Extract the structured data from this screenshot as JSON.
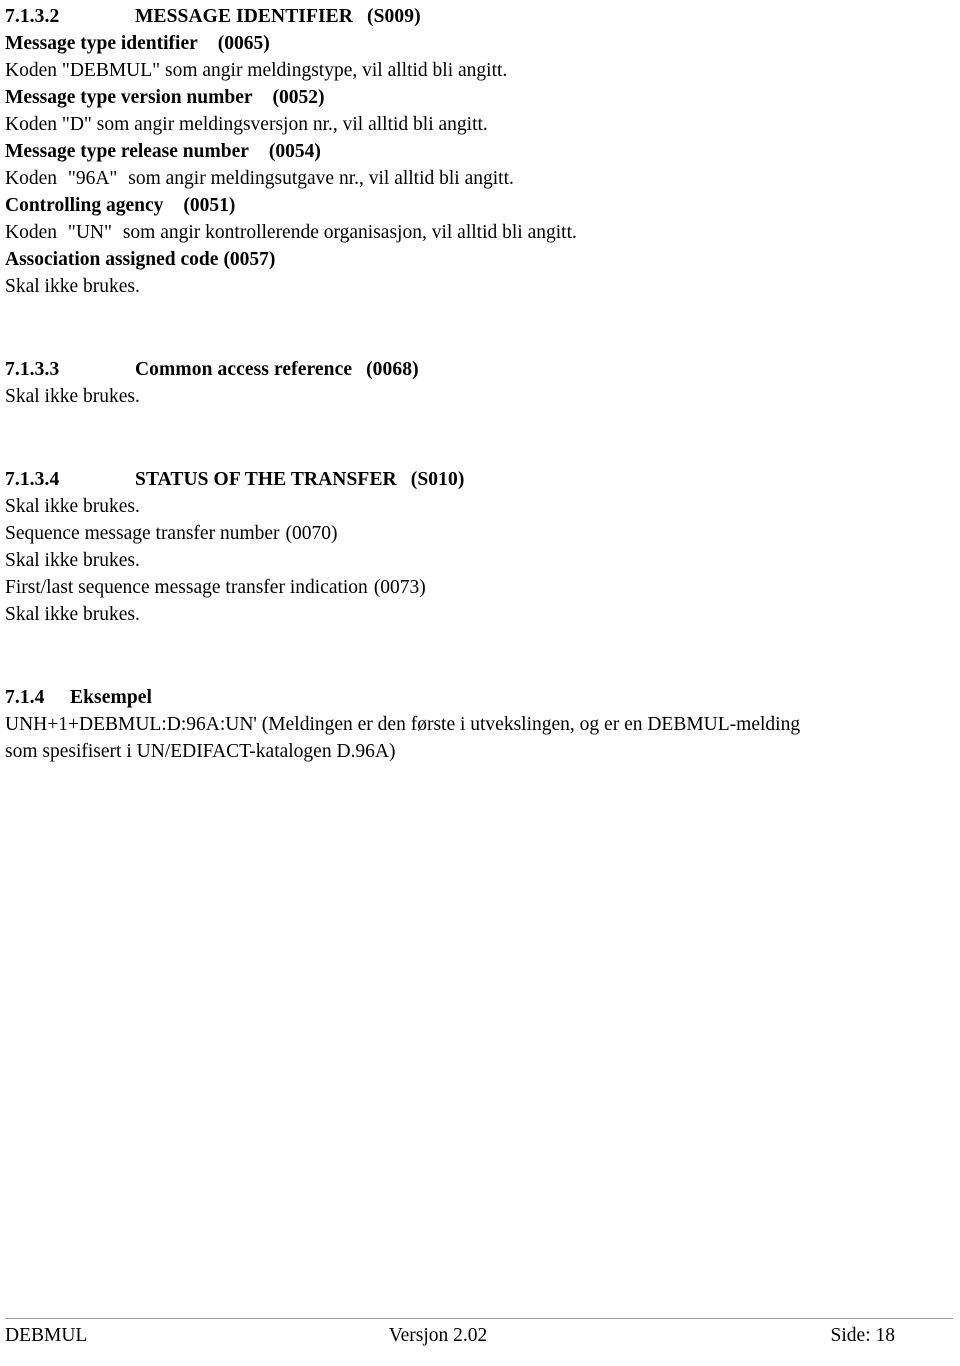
{
  "document": {
    "sections": [
      {
        "id": "7.1.3.2",
        "number": "7.1.3.2",
        "title": "MESSAGE IDENTIFIER",
        "code": "(S009)",
        "elements": [
          {
            "name": "Message type identifier",
            "code": "(0065)",
            "text": "Koden \"DEBMUL\" som angir meldingstype, vil alltid bli angitt."
          },
          {
            "name": "Message type version number",
            "code": "(0052)",
            "text": "Koden \"D\" som angir meldingsversjon nr., vil alltid bli angitt."
          },
          {
            "name": "Message type release number",
            "code": "(0054)",
            "text_prefix": "Koden",
            "text_quoted": "\"96A\"",
            "text_suffix": "som angir meldingsutgave nr., vil alltid bli angitt."
          },
          {
            "name": "Controlling agency",
            "code": "(0051)",
            "text_prefix": "Koden",
            "text_quoted": "\"UN\"",
            "text_suffix": "som angir kontrollerende organisasjon, vil alltid bli angitt."
          },
          {
            "name": "Association assigned code",
            "code": "(0057)",
            "text": "Skal ikke brukes."
          }
        ]
      },
      {
        "id": "7.1.3.3",
        "number": "7.1.3.3",
        "title": "Common access reference",
        "code": "(0068)",
        "body": "Skal ikke brukes."
      },
      {
        "id": "7.1.3.4",
        "number": "7.1.3.4",
        "title": "STATUS OF THE TRANSFER",
        "code": "(S010)",
        "body": "Skal ikke brukes.",
        "elements": [
          {
            "name": "Sequence message transfer number",
            "code": "(0070)",
            "text": "Skal ikke brukes."
          },
          {
            "name": "First/last sequence message transfer indication",
            "code": "(0073)",
            "text": "Skal ikke brukes."
          }
        ]
      },
      {
        "id": "7.1.4",
        "number": "7.1.4",
        "title": "Eksempel",
        "example_line_1": "UNH+1+DEBMUL:D:96A:UN' (Meldingen er den første i utvekslingen, og er en DEBMUL-melding",
        "example_line_2": "som spesifisert i UN/EDIFACT-katalogen D.96A)"
      }
    ]
  },
  "footer": {
    "left": "DEBMUL",
    "center": "Versjon 2.02",
    "right": "Side: 18"
  }
}
